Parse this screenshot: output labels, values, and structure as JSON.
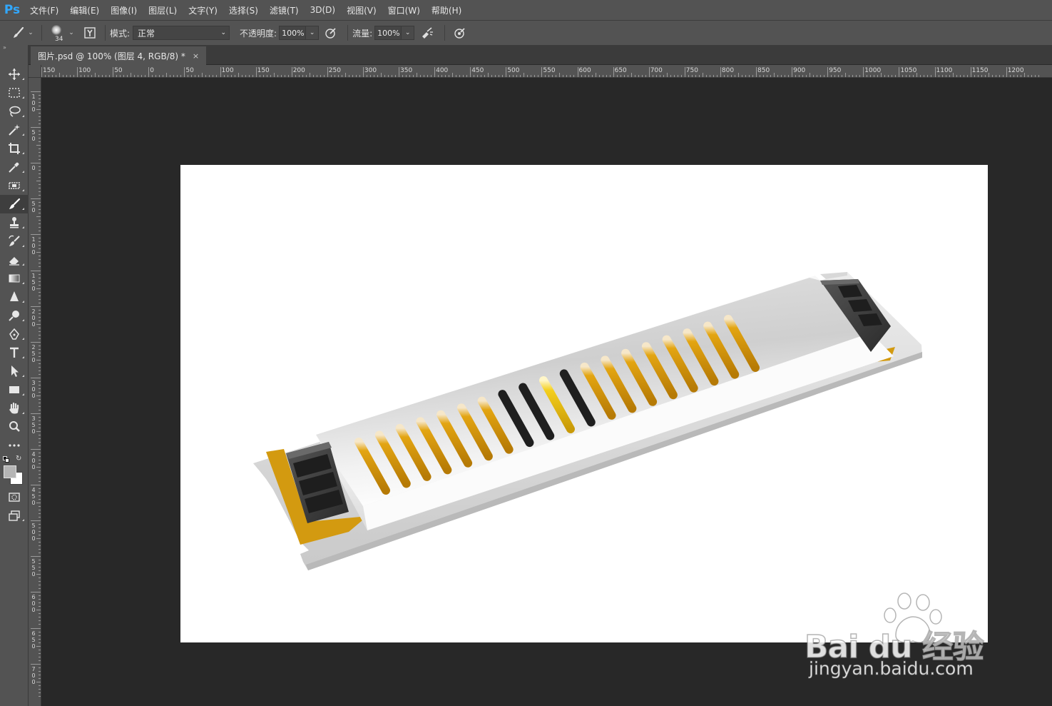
{
  "app": {
    "logo": "Ps"
  },
  "menu": [
    "文件(F)",
    "编辑(E)",
    "图像(I)",
    "图层(L)",
    "文字(Y)",
    "选择(S)",
    "滤镜(T)",
    "3D(D)",
    "视图(V)",
    "窗口(W)",
    "帮助(H)"
  ],
  "options": {
    "brush_size": "34",
    "mode_label": "模式:",
    "mode_value": "正常",
    "opacity_label": "不透明度:",
    "opacity_value": "100%",
    "flow_label": "流量:",
    "flow_value": "100%"
  },
  "document_tab": {
    "title": "图片.psd @ 100% (图层 4, RGB/8) *",
    "close": "×"
  },
  "ruler_top": [
    "150",
    "100",
    "50",
    "0",
    "50",
    "100",
    "150",
    "200",
    "250",
    "300",
    "350",
    "400",
    "450",
    "500",
    "550",
    "600",
    "650",
    "700",
    "750",
    "800",
    "850",
    "900",
    "950",
    "1000",
    "1050",
    "1100",
    "1150",
    "1200"
  ],
  "ruler_left": [
    "1 0 0",
    "5 0",
    "0",
    "5 0",
    "1 0 0",
    "1 5 0",
    "2 0 0",
    "2 5 0",
    "3 0 0",
    "3 5 0",
    "4 0 0",
    "4 5 0",
    "5 0 0",
    "5 5 0",
    "6 0 0",
    "6 5 0",
    "7 0 0"
  ],
  "tools": [
    "move-tool",
    "marquee-tool",
    "lasso-tool",
    "magic-wand-tool",
    "crop-tool",
    "eyedropper-tool",
    "healing-brush-tool",
    "brush-tool",
    "clone-stamp-tool",
    "history-brush-tool",
    "eraser-tool",
    "gradient-tool",
    "blur-tool",
    "dodge-tool",
    "pen-tool",
    "type-tool",
    "path-selection-tool",
    "rectangle-tool",
    "hand-tool",
    "zoom-tool",
    "more-tools"
  ],
  "colors": {
    "ui_bg": "#535353",
    "pasteboard": "#282828",
    "accent": "#31a8ff",
    "foreground": "#b5b5b5",
    "background": "#ffffff"
  },
  "watermark": {
    "brand": "Bai du 经验",
    "url": "jingyan.baidu.com"
  }
}
